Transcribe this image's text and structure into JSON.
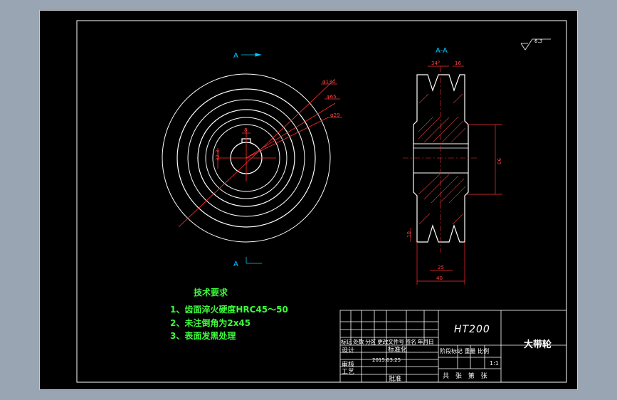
{
  "section_marks": {
    "top": "A",
    "bottom": "A",
    "section_title": "A-A"
  },
  "surface_finish": "6.3",
  "front_view_dims": {
    "d1": "φ134",
    "d2": "φ65",
    "d3": "φ29",
    "keyway_width": "8",
    "keyway_depth": "32.3"
  },
  "section_dims": {
    "top_width": "34°",
    "top_right": "16",
    "height_right": "90",
    "bottom_left": "10",
    "bottom_mid": "25",
    "overall_width": "40"
  },
  "tech_requirements": {
    "title": "技术要求",
    "items": [
      "1、齿面淬火硬度HRC45～50",
      "2、未注倒角为2x45",
      "3、表面发黑处理"
    ]
  },
  "title_block": {
    "material": "HT200",
    "part_name": "大带轮",
    "rev_header": "标记 处数 分区 更改文件号 签名 年月日",
    "designer_label": "设计",
    "std_label": "标准化",
    "checker_label": "审核",
    "process_label": "工艺",
    "approve_label": "批准",
    "date": "2015.03.25",
    "stage_label": "阶段标记 重量 比例",
    "scale": "1:1",
    "sheet_label": "共 张 第 张"
  },
  "colors": {
    "background": "#000000",
    "lines": "#ffffff",
    "dims": "#ff2020",
    "centerline": "#ff3030",
    "annot": "#00c8ff",
    "tech": "#3cff3c"
  }
}
